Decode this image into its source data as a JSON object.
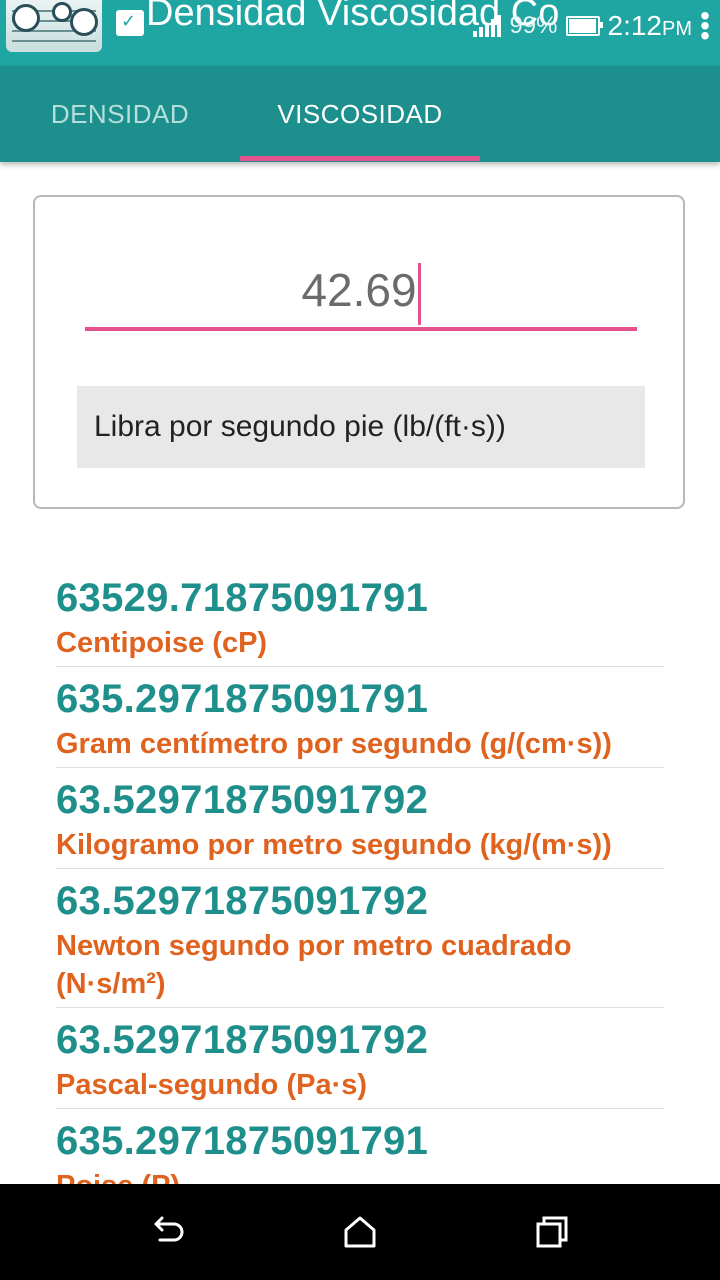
{
  "status_bar": {
    "app_title": "Densidad Viscosidad Co",
    "battery_percent": "99%",
    "time": "2:12",
    "ampm": "PM"
  },
  "tabs": [
    {
      "label": "DENSIDAD",
      "selected": false
    },
    {
      "label": "VISCOSIDAD",
      "selected": true
    }
  ],
  "input": {
    "value": "42.69",
    "unit_selected": "Libra por segundo pie (lb/(ft·s))"
  },
  "results": [
    {
      "value": "63529.71875091791",
      "unit": "Centipoise (cP)"
    },
    {
      "value": "635.2971875091791",
      "unit": "Gram centímetro por segundo (g/(cm·s))"
    },
    {
      "value": "63.52971875091792",
      "unit": "Kilogramo por metro segundo (kg/(m·s))"
    },
    {
      "value": "63.52971875091792",
      "unit": "Newton segundo por metro cuadrado (N·s/m²)"
    },
    {
      "value": "63.52971875091792",
      "unit": "Pascal-segundo (Pa·s)"
    },
    {
      "value": "635.2971875091791",
      "unit": "Poise (P)"
    }
  ],
  "colors": {
    "status_bar": "#1fa5a2",
    "tab_bar": "#1d8f8c",
    "accent": "#e4528f",
    "value_text": "#1f8f8c",
    "unit_text": "#e0621f"
  },
  "icons": {
    "nav_back": "back-icon",
    "nav_home": "home-icon",
    "nav_recents": "recents-icon"
  }
}
